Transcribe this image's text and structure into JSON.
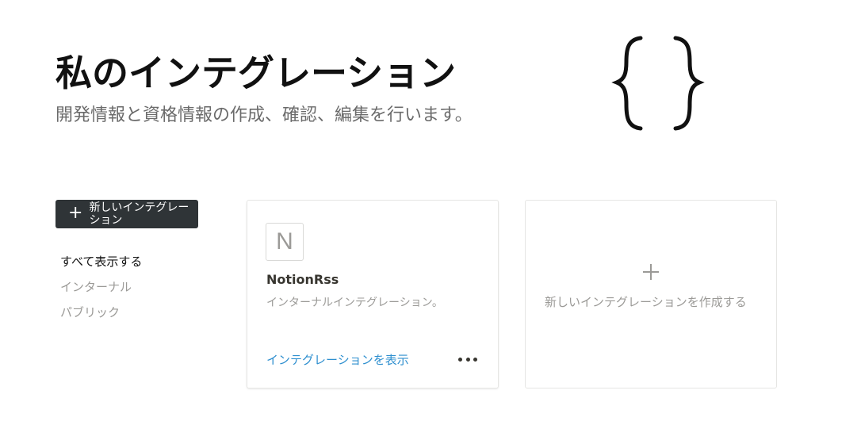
{
  "header": {
    "title": "私のインテグレーション",
    "subtitle": "開発情報と資格情報の作成、確認、編集を行います。",
    "decoration_icon": "curly-braces-icon"
  },
  "sidebar": {
    "new_button": {
      "icon": "plus-icon",
      "label": "新しいインテグレーション"
    },
    "filters": [
      {
        "label": "すべて表示する",
        "active": true
      },
      {
        "label": "インターナル",
        "active": false
      },
      {
        "label": "パブリック",
        "active": false
      }
    ]
  },
  "integrations": [
    {
      "icon_letter": "N",
      "name": "NotionRss",
      "type": "インターナルインテグレーション。",
      "view_link": "インテグレーションを表示",
      "more_icon": "ellipsis-icon"
    }
  ],
  "create_card": {
    "icon": "plus-icon",
    "label": "新しいインテグレーションを作成する"
  },
  "colors": {
    "text": "#37352f",
    "muted": "#9b9a97",
    "link": "#2e8fcf",
    "button_bg": "#2f3437",
    "border": "#e6e6e4"
  }
}
